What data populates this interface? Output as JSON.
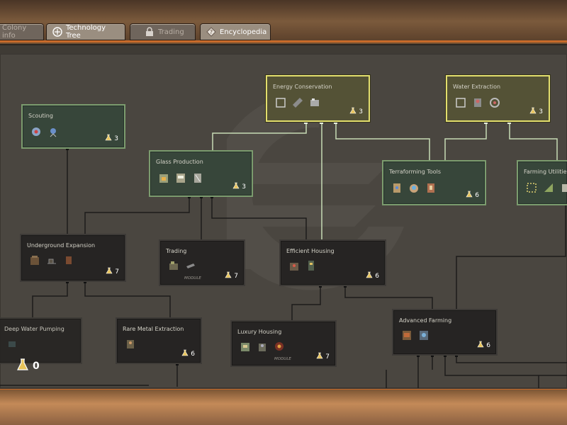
{
  "tabs": [
    {
      "label": "Colony info",
      "icon": "colony-icon"
    },
    {
      "label": "Technology Tree",
      "icon": "tree-icon"
    },
    {
      "label": "Trading",
      "icon": "lock-icon"
    },
    {
      "label": "Encyclopedia",
      "icon": "encyclopedia-icon"
    }
  ],
  "research": {
    "points": "0",
    "icon": "flask-icon"
  },
  "nodes": {
    "scouting": {
      "name": "Scouting",
      "cost": "3"
    },
    "energy_conservation": {
      "name": "Energy Conservation",
      "cost": "3"
    },
    "water_extraction": {
      "name": "Water Extraction",
      "cost": "3"
    },
    "glass_production": {
      "name": "Glass Production",
      "cost": "3"
    },
    "terraforming_tools": {
      "name": "Terraforming Tools",
      "cost": "6"
    },
    "farming_utilities": {
      "name": "Farming Utilities",
      "cost": ""
    },
    "underground_expansion": {
      "name": "Underground Expansion",
      "cost": "7"
    },
    "trading": {
      "name": "Trading",
      "cost": "7",
      "module": "MODULE"
    },
    "efficient_housing": {
      "name": "Efficient Housing",
      "cost": "6"
    },
    "deep_water_pumping": {
      "name": "Deep Water Pumping",
      "cost": ""
    },
    "rare_metal_extraction": {
      "name": "Rare Metal Extraction",
      "cost": "6"
    },
    "luxury_housing": {
      "name": "Luxury Housing",
      "cost": "7",
      "module": "MODULE"
    },
    "advanced_farming": {
      "name": "Advanced Farming",
      "cost": "6"
    }
  },
  "colors": {
    "unlocked_border": "#e2de6e",
    "available_border": "#7b9c6e",
    "locked_bg": "#262423",
    "link_available": "#c7dbb6",
    "link_locked": "#1c1b1a",
    "accent_orange": "#c76a2a"
  }
}
